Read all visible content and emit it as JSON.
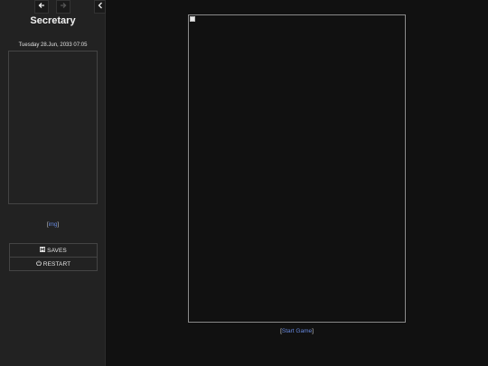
{
  "sidebar": {
    "history": {
      "back_icon": "arrow-left-icon",
      "forward_icon": "arrow-right-icon",
      "stow_icon": "chevron-left-icon"
    },
    "story_title": "Secretary",
    "date_text": "Tuesday 28.Jun, 2033 07:05",
    "img_link": {
      "open_bracket": "[",
      "label": "img",
      "close_bracket": "]"
    },
    "menu": {
      "saves_label": "SAVES",
      "saves_icon": "floppy-disk-icon",
      "restart_label": "RESTART",
      "restart_icon": "power-icon"
    }
  },
  "passage": {
    "start_link": {
      "open_bracket": "[",
      "label": "Start Game",
      "close_bracket": "]"
    }
  },
  "colors": {
    "sidebar_bg": "#222222",
    "main_bg": "#111111",
    "link": "#6688dd",
    "border": "#444444"
  }
}
